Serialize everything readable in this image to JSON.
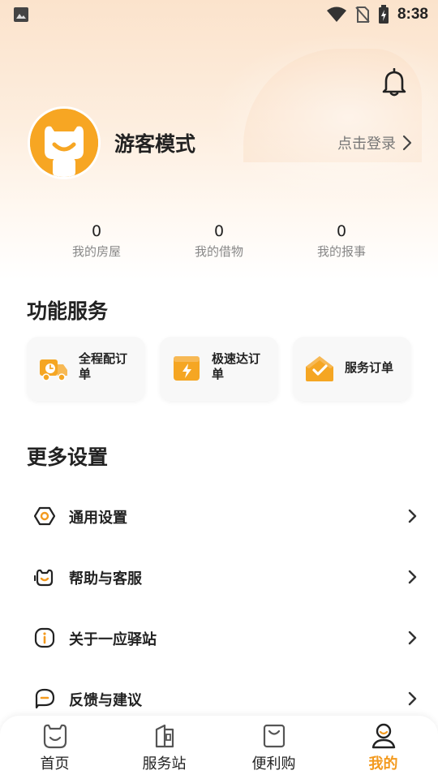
{
  "status_bar": {
    "time": "8:38"
  },
  "profile": {
    "name": "游客模式",
    "login_label": "点击登录"
  },
  "stats": [
    {
      "value": "0",
      "label": "我的房屋"
    },
    {
      "value": "0",
      "label": "我的借物"
    },
    {
      "value": "0",
      "label": "我的报事"
    }
  ],
  "services": {
    "title": "功能服务",
    "items": [
      {
        "label": "全程配订单",
        "icon": "delivery-truck-icon"
      },
      {
        "label": "极速达订单",
        "icon": "express-box-icon"
      },
      {
        "label": "服务订单",
        "icon": "service-house-icon"
      }
    ]
  },
  "settings": {
    "title": "更多设置",
    "items": [
      {
        "label": "通用设置",
        "icon": "gear-icon"
      },
      {
        "label": "帮助与客服",
        "icon": "customer-service-icon"
      },
      {
        "label": "关于一应驿站",
        "icon": "info-icon"
      },
      {
        "label": "反馈与建议",
        "icon": "feedback-icon"
      }
    ]
  },
  "tabbar": {
    "items": [
      {
        "label": "首页",
        "icon": "home-icon"
      },
      {
        "label": "服务站",
        "icon": "service-station-icon"
      },
      {
        "label": "便利购",
        "icon": "shopping-bag-icon"
      },
      {
        "label": "我的",
        "icon": "profile-icon"
      }
    ],
    "active_index": 3
  },
  "colors": {
    "accent": "#f39a1f",
    "hero_gradient_top": "#fbe3cc",
    "card_bg": "#f8f8f8"
  }
}
